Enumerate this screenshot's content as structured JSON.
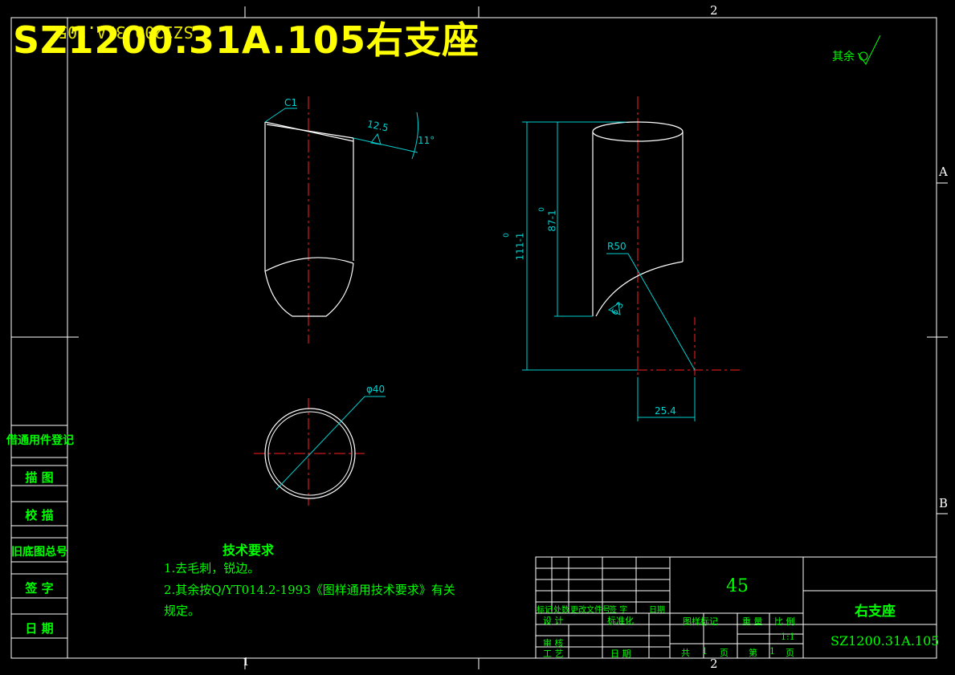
{
  "drawing": {
    "title_banner": "SZ1200.31A.105右支座",
    "title_banner_mirrored": "SZ1200.31A.105",
    "surface_note": "其余",
    "zone_labels": {
      "top_col": "2",
      "bottom_col_left": "1",
      "bottom_col_right": "2",
      "row_a": "A",
      "row_b": "B"
    }
  },
  "dimensions": {
    "chamfer": "C1",
    "roughness_top": "12.5",
    "angle": "11°",
    "overall_height": "111-1",
    "overall_height_sup": "0",
    "inner_height": "87-1",
    "inner_height_sup": "0",
    "radius": "R50",
    "roughness_arc": "6.3",
    "offset": "25.4",
    "diameter": "φ40"
  },
  "sidebar": {
    "cells": [
      "借通用件登记",
      "描 图",
      "校 描",
      "旧底图总号",
      "签 字",
      "日 期"
    ]
  },
  "tech_requirements": {
    "heading": "技术要求",
    "line1": "1.去毛刺，锐边。",
    "line2": "2.其余按Q/YT014.2-1993《图样通用技术要求》有关",
    "line3": "规定。"
  },
  "title_block": {
    "material": "45",
    "part_name": "右支座",
    "part_code": "SZ1200.31A.105",
    "rev_headers": [
      "标记",
      "处数",
      "更改文件号",
      "签 字",
      "日期"
    ],
    "design": "设 计",
    "standardize": "标准化",
    "review": "审 核",
    "process": "工 艺",
    "date": "日 期",
    "stage_mark": "图样标记",
    "weight": "重 量",
    "scale_label": "比 例",
    "scale": "1:1",
    "total_label": "共",
    "total_pages": "1",
    "page_unit": "页",
    "sheet_label": "第",
    "sheet_no": "1",
    "sheet_unit": "页"
  },
  "colors": {
    "background": "#000000",
    "outline": "#ffffff",
    "dimension": "#00d0d0",
    "centerline": "#ff2020",
    "text": "#00ff00",
    "banner": "#ffff00"
  }
}
